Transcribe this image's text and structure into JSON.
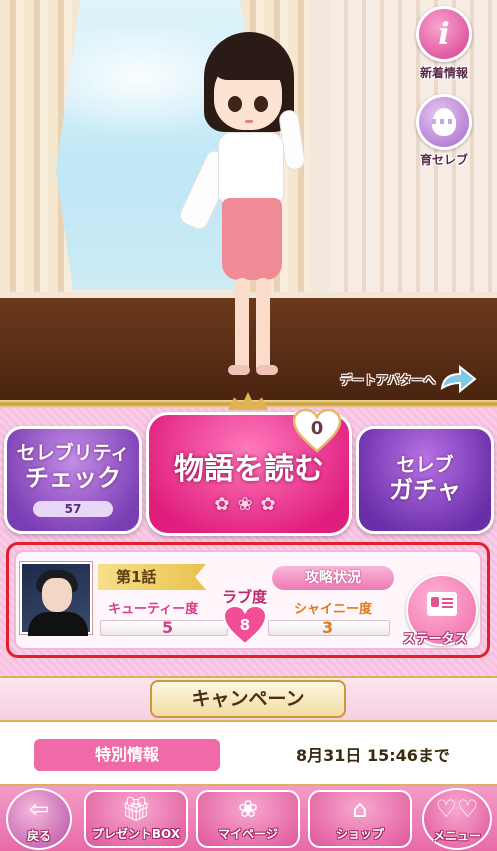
{
  "top_buttons": {
    "info_label": "新着情報",
    "celeb_label": "育セレブ",
    "info_glyph": "i"
  },
  "date_avatar": {
    "label": "デートアバターへ"
  },
  "main_buttons": {
    "celebrity_line1": "セレブリティ",
    "celebrity_line2": "チェック",
    "celebrity_count": "57",
    "read_story": "物語を読む",
    "heart_count": "0",
    "gacha_line1": "セレブ",
    "gacha_line2": "ガチャ"
  },
  "status": {
    "chapter": "第1話",
    "strategy_label": "攻略状況",
    "cute_label": "キューティー度",
    "cute_value": "5",
    "love_label": "ラブ度",
    "love_value": "8",
    "shiny_label": "シャイニー度",
    "shiny_value": "3",
    "status_button": "ステータス"
  },
  "campaign": {
    "title": "キャンペーン",
    "special": "特別情報",
    "deadline": "8月31日 15:46まで"
  },
  "nav": {
    "back": "戻る",
    "present": "プレゼントBOX",
    "mypage": "マイページ",
    "shop": "ショップ",
    "menu": "メニュー"
  },
  "colors": {
    "accent_pink": "#e01e7d",
    "highlight_frame": "#e1202a",
    "gold": "#d9b25a"
  }
}
